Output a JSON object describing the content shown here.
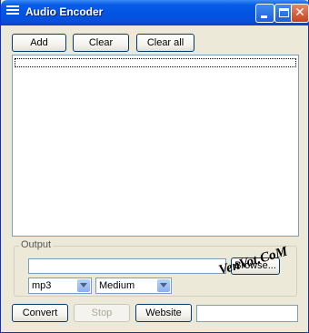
{
  "window": {
    "title": "Audio Encoder",
    "close_glyph": "✕"
  },
  "toolbar": {
    "add_label": "Add",
    "clear_label": "Clear",
    "clear_all_label": "Clear all"
  },
  "output": {
    "group_label": "Output",
    "path_value": "",
    "browse_label": "Browse...",
    "format_selected": "mp3",
    "quality_selected": "Medium"
  },
  "actions": {
    "convert_label": "Convert",
    "stop_label": "Stop",
    "website_label": "Website",
    "status_value": ""
  },
  "watermark": "VenVot.CoM"
}
